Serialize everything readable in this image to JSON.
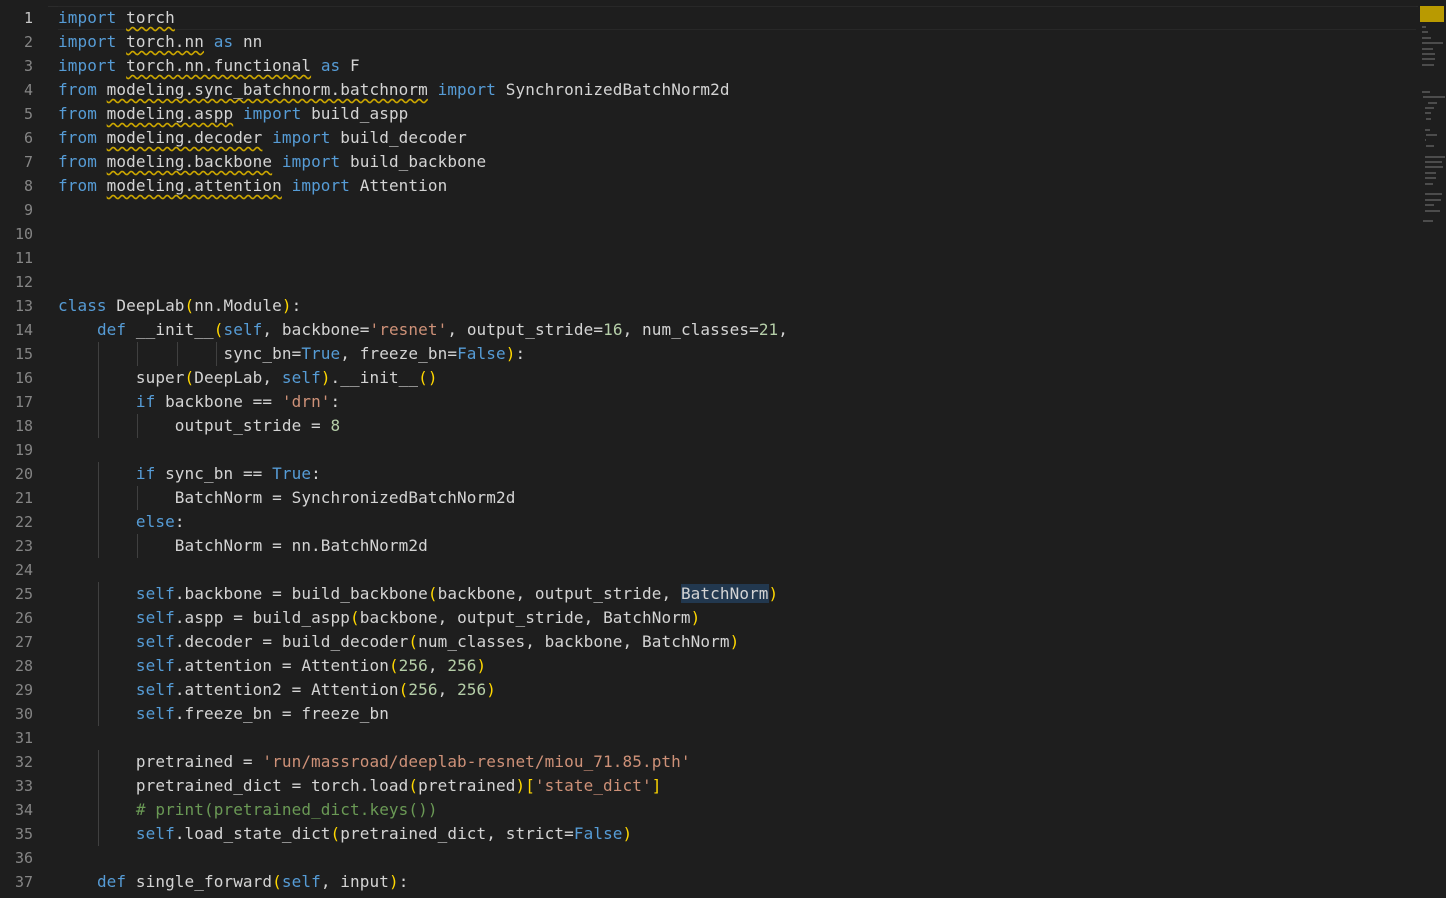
{
  "editor": {
    "language": "python",
    "active_line": 1,
    "lines": [
      "import torch",
      "import torch.nn as nn",
      "import torch.nn.functional as F",
      "from modeling.sync_batchnorm.batchnorm import SynchronizedBatchNorm2d",
      "from modeling.aspp import build_aspp",
      "from modeling.decoder import build_decoder",
      "from modeling.backbone import build_backbone",
      "from modeling.attention import Attention",
      "",
      "",
      "",
      "",
      "class DeepLab(nn.Module):",
      "    def __init__(self, backbone='resnet', output_stride=16, num_classes=21,",
      "                 sync_bn=True, freeze_bn=False):",
      "        super(DeepLab, self).__init__()",
      "        if backbone == 'drn':",
      "            output_stride = 8",
      "",
      "        if sync_bn == True:",
      "            BatchNorm = SynchronizedBatchNorm2d",
      "        else:",
      "            BatchNorm = nn.BatchNorm2d",
      "",
      "        self.backbone = build_backbone(backbone, output_stride, BatchNorm)",
      "        self.aspp = build_aspp(backbone, output_stride, BatchNorm)",
      "        self.decoder = build_decoder(num_classes, backbone, BatchNorm)",
      "        self.attention = Attention(256, 256)",
      "        self.attention2 = Attention(256, 256)",
      "        self.freeze_bn = freeze_bn",
      "",
      "        pretrained = 'run/massroad/deeplab-resnet/miou_71.85.pth'",
      "        pretrained_dict = torch.load(pretrained)['state_dict']",
      "        # print(pretrained_dict.keys())",
      "        self.load_state_dict(pretrained_dict, strict=False)",
      "",
      "    def single_forward(self, input):"
    ]
  }
}
